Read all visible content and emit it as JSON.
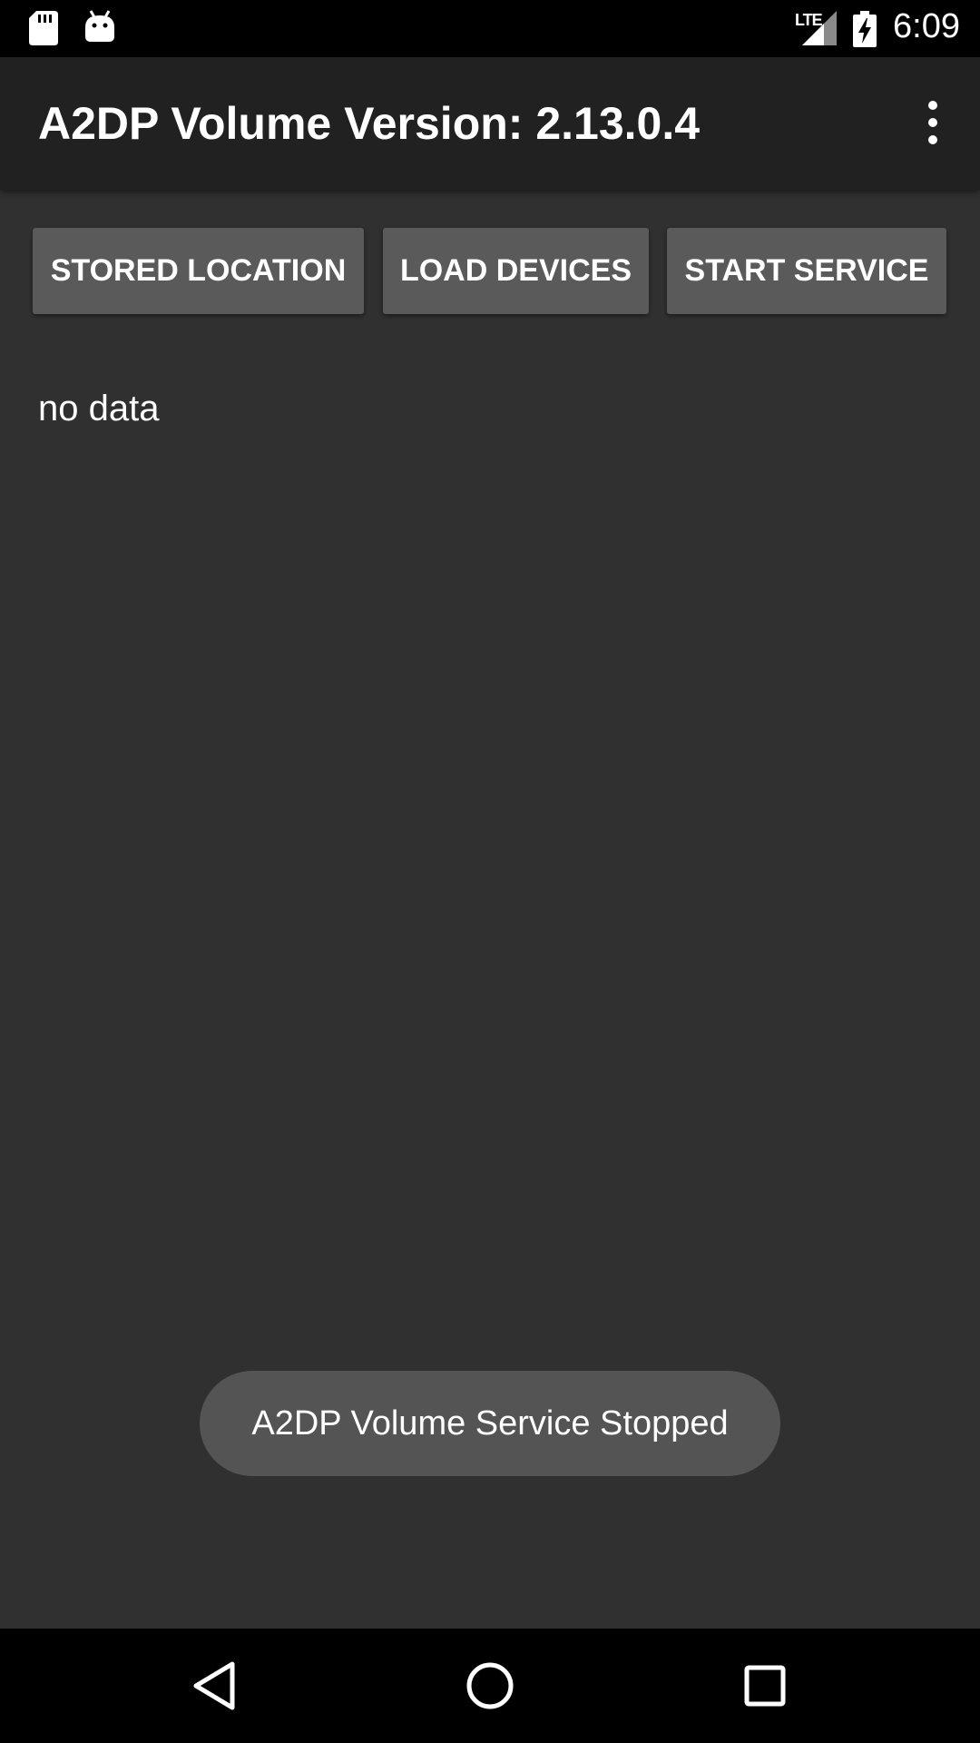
{
  "status_bar": {
    "time": "6:09",
    "network_label": "LTE",
    "icons": [
      "sd-card-icon",
      "android-debug-icon",
      "signal-icon",
      "battery-charging-icon"
    ]
  },
  "app_bar": {
    "title": "A2DP Volume Version: 2.13.0.4",
    "overflow_icon": "more-vert-icon"
  },
  "buttons": {
    "stored_location": "STORED LOCATION",
    "load_devices": "LOAD DEVICES",
    "start_service": "START SERVICE"
  },
  "content": {
    "status_text": "no data"
  },
  "toast": {
    "message": "A2DP Volume Service Stopped"
  },
  "nav_bar": {
    "icons": [
      "back-icon",
      "home-icon",
      "recents-icon"
    ]
  },
  "colors": {
    "background": "#303030",
    "app_bar": "#212121",
    "button": "#5a5a5a",
    "toast": "#545454",
    "text": "#ffffff"
  }
}
